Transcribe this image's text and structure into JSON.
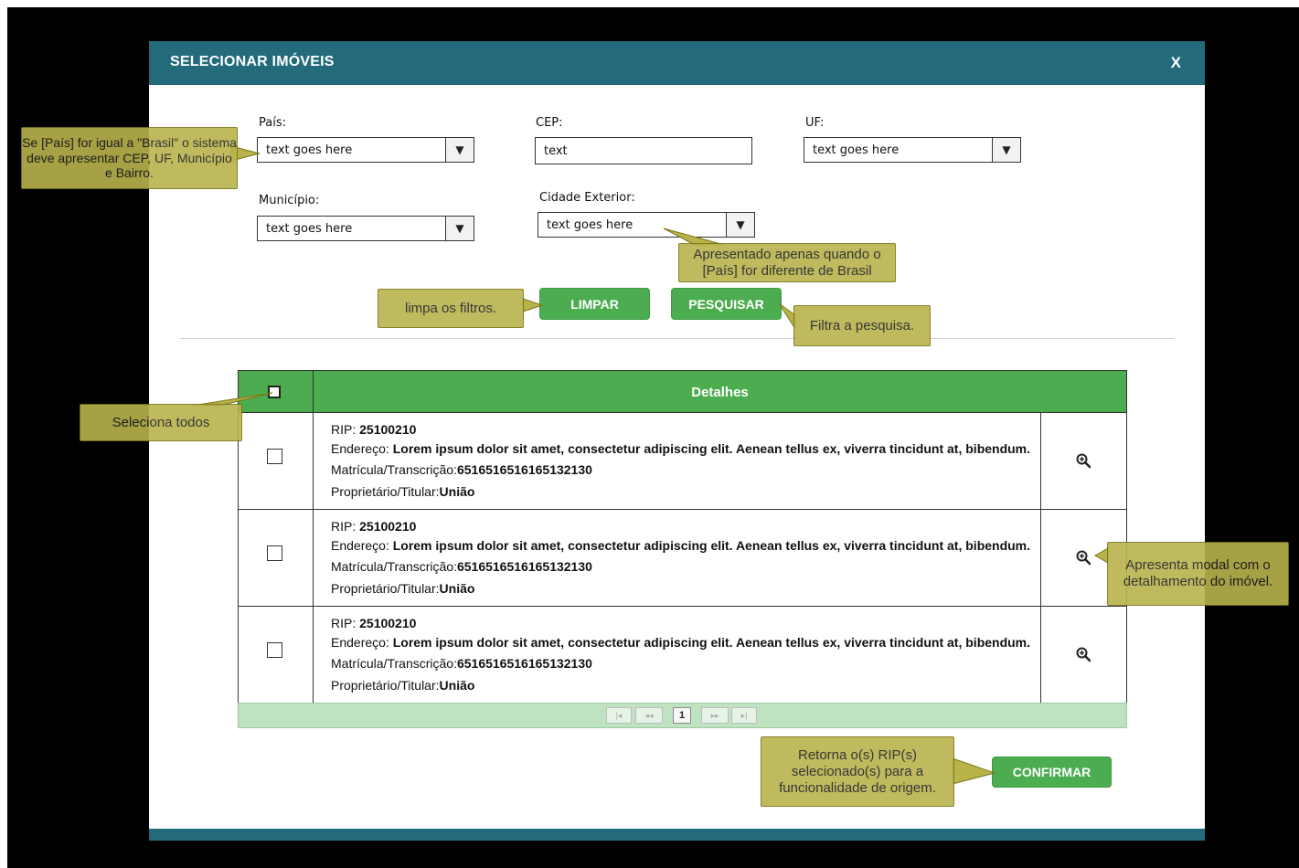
{
  "modal": {
    "title": "SELECIONAR IMÓVEIS",
    "close": "X"
  },
  "filters": {
    "pais": {
      "label": "País:",
      "value": "text goes here"
    },
    "cep": {
      "label": "CEP:",
      "value": "text"
    },
    "uf": {
      "label": "UF:",
      "value": "text goes here"
    },
    "municipio": {
      "label": "Município:",
      "value": "text goes here"
    },
    "cidade_exterior": {
      "label": "Cidade Exterior:",
      "value": "text goes here"
    }
  },
  "buttons": {
    "limpar": "LIMPAR",
    "pesquisar": "PESQUISAR",
    "confirmar": "CONFIRMAR"
  },
  "grid": {
    "header": "Detalhes",
    "rows": [
      {
        "rip_label": "RIP:",
        "rip": "25100210",
        "endereco_label": "Endereço:",
        "endereco": "Lorem ipsum dolor sit amet, consectetur adipiscing elit. Aenean tellus ex, viverra tincidunt at, bibendum.",
        "matricula_label": "Matrícula/Transcrição:",
        "matricula": "6516516516165132130",
        "proprietario_label": "Proprietário/Titular:",
        "proprietario": "União"
      },
      {
        "rip_label": "RIP:",
        "rip": "25100210",
        "endereco_label": "Endereço:",
        "endereco": "Lorem ipsum dolor sit amet, consectetur adipiscing elit. Aenean tellus ex, viverra tincidunt at, bibendum.",
        "matricula_label": "Matrícula/Transcrição:",
        "matricula": "6516516516165132130",
        "proprietario_label": "Proprietário/Titular:",
        "proprietario": "União"
      },
      {
        "rip_label": "RIP:",
        "rip": "25100210",
        "endereco_label": "Endereço:",
        "endereco": "Lorem ipsum dolor sit amet, consectetur adipiscing elit. Aenean tellus ex, viverra tincidunt at, bibendum.",
        "matricula_label": "Matrícula/Transcrição:",
        "matricula": "6516516516165132130",
        "proprietario_label": "Proprietário/Titular:",
        "proprietario": "União"
      }
    ],
    "pager": {
      "first": "|◂",
      "prev": "◂◂",
      "current": "1",
      "next": "▸▸",
      "last": "▸|"
    }
  },
  "notes": {
    "pais": "Se [País] for igual a \"Brasil\" o sistema deve apresentar CEP, UF, Município e Bairro.",
    "cidade_exterior": "Apresentado apenas quando o [País] for diferente de Brasil",
    "limpar": "limpa os filtros.",
    "pesquisar": "Filtra a pesquisa.",
    "seleciona": "Seleciona todos",
    "detalhe": "Apresenta modal com o detalhamento do imóvel.",
    "confirmar": "Retorna o(s) RIP(s) selecionado(s) para a funcionalidade de origem."
  },
  "colors": {
    "header": "#236b7b",
    "accent_green": "#4cad50",
    "note_bg": "#b9b34c",
    "backdrop": "#000000"
  },
  "icons": {
    "row_detail": "zoom-in-icon",
    "dropdown": "triangle-down-icon"
  }
}
